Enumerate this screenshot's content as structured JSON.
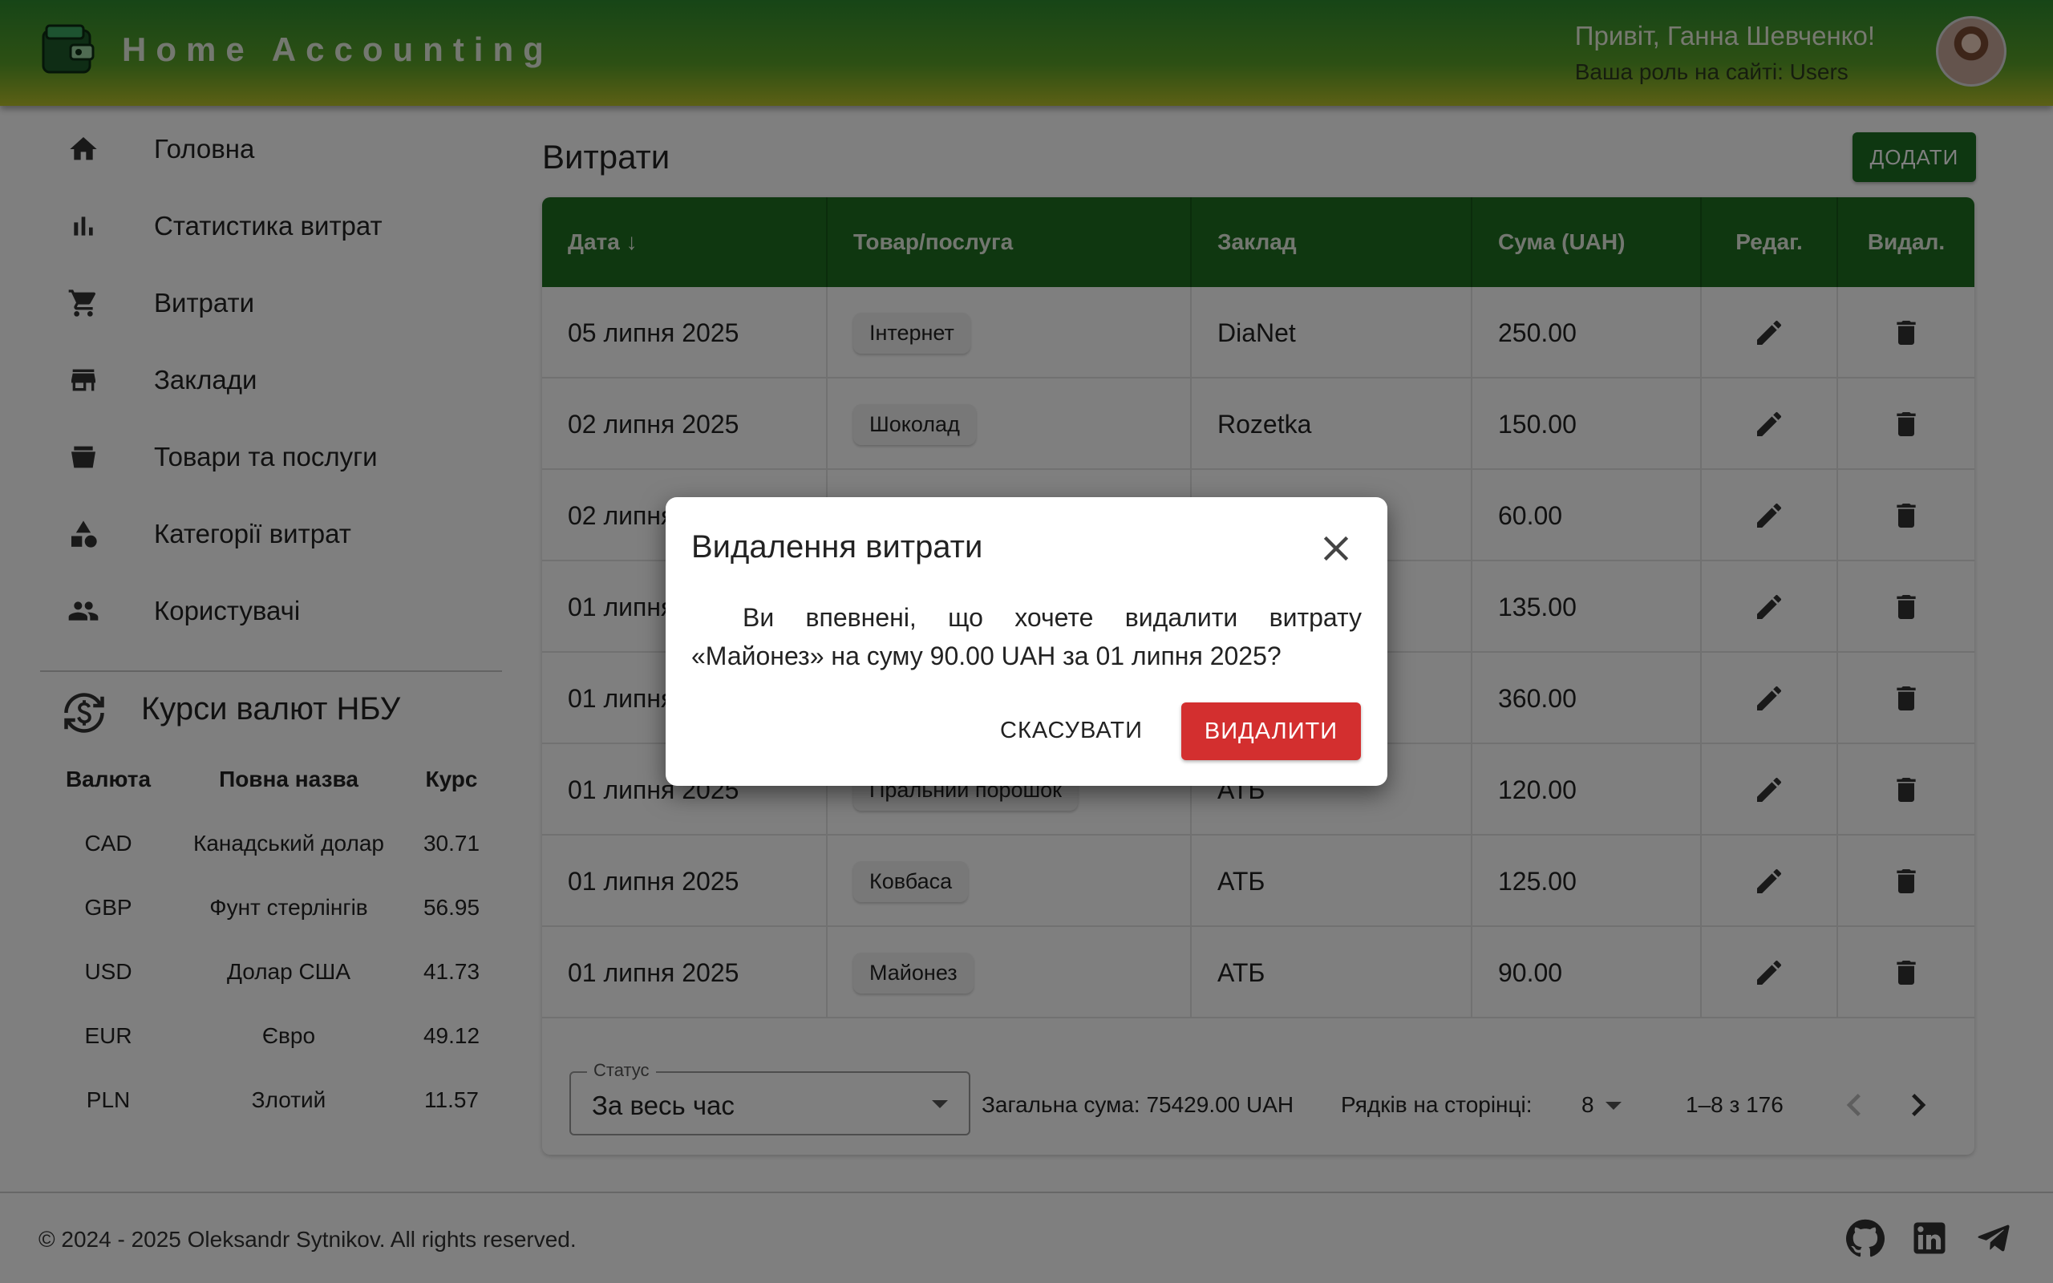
{
  "header": {
    "app_title": "Home Accounting",
    "greeting": "Привіт, Ганна Шевченко!",
    "role": "Ваша роль на сайті: Users"
  },
  "sidebar": {
    "items": [
      {
        "label": "Головна",
        "icon": "home-icon"
      },
      {
        "label": "Статистика витрат",
        "icon": "bar-chart-icon"
      },
      {
        "label": "Витрати",
        "icon": "cart-icon"
      },
      {
        "label": "Заклади",
        "icon": "store-icon"
      },
      {
        "label": "Товари та послуги",
        "icon": "basket-icon"
      },
      {
        "label": "Категорії витрат",
        "icon": "category-icon"
      },
      {
        "label": "Користувачі",
        "icon": "users-icon"
      }
    ],
    "rates": {
      "title": "Курси валют НБУ",
      "headers": {
        "currency": "Валюта",
        "name": "Повна назва",
        "rate": "Курс"
      },
      "rows": [
        {
          "code": "CAD",
          "name": "Канадський долар",
          "rate": "30.71"
        },
        {
          "code": "GBP",
          "name": "Фунт стерлінгів",
          "rate": "56.95"
        },
        {
          "code": "USD",
          "name": "Долар США",
          "rate": "41.73"
        },
        {
          "code": "EUR",
          "name": "Євро",
          "rate": "49.12"
        },
        {
          "code": "PLN",
          "name": "Злотий",
          "rate": "11.57"
        }
      ]
    }
  },
  "main": {
    "title": "Витрати",
    "add_label": "ДОДАТИ",
    "columns": {
      "date": "Дата ↓",
      "product": "Товар/послуга",
      "shop": "Заклад",
      "sum": "Сума (UAH)",
      "edit": "Редаг.",
      "delete": "Видал."
    },
    "rows": [
      {
        "date": "05 липня 2025",
        "product": "Інтернет",
        "shop": "DiaNet",
        "sum": "250.00"
      },
      {
        "date": "02 липня 2025",
        "product": "Шоколад",
        "shop": "Rozetka",
        "sum": "150.00"
      },
      {
        "date": "02 липня 2025",
        "product": "",
        "shop": "",
        "sum": "60.00"
      },
      {
        "date": "01 липня 2025",
        "product": "",
        "shop": "",
        "sum": "135.00"
      },
      {
        "date": "01 липня 2025",
        "product": "",
        "shop": "",
        "sum": "360.00"
      },
      {
        "date": "01 липня 2025",
        "product": "Пральний порошок",
        "shop": "АТБ",
        "sum": "120.00"
      },
      {
        "date": "01 липня 2025",
        "product": "Ковбаса",
        "shop": "АТБ",
        "sum": "125.00"
      },
      {
        "date": "01 липня 2025",
        "product": "Майонез",
        "shop": "АТБ",
        "sum": "90.00"
      }
    ],
    "status_label": "Статус",
    "status_value": "За весь час",
    "total": "Загальна сума: 75429.00 UAH",
    "rows_per_page_label": "Рядків на сторінці:",
    "rows_per_page": "8",
    "page_range": "1–8 з 176"
  },
  "footer": {
    "copyright": "© 2024 - 2025 Oleksandr Sytnikov. All rights reserved."
  },
  "dialog": {
    "title": "Видалення витрати",
    "message": "Ви впевнені, що хочете видалити витрату «Майонез» на суму 90.00 UAH за 01 липня 2025?",
    "cancel_label": "СКАСУВАТИ",
    "delete_label": "ВИДАЛИТИ"
  },
  "colors": {
    "primary": "#1e6e21",
    "danger": "#d32f2f",
    "header_gradient_top": "#2e8b2e",
    "header_gradient_bottom": "#b8c02a"
  }
}
